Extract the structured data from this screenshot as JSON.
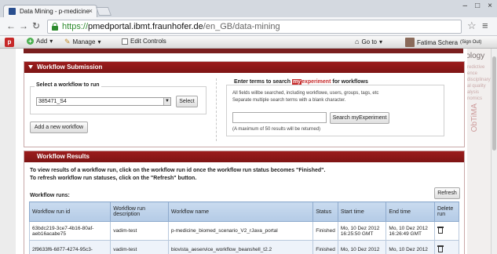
{
  "browser": {
    "tab_title": "Data Mining - p-medicine",
    "tab_close": "×",
    "window_controls": [
      "–",
      "□",
      "×"
    ],
    "url_scheme": "https://",
    "url_host": "pmedportal.ibmt.fraunhofer.de",
    "url_path": "/en_GB/data-mining",
    "back": "←",
    "forward": "→",
    "reload": "↻",
    "star": "☆",
    "menu": "≡"
  },
  "portalbar": {
    "logo": "p",
    "add_label": "Add",
    "manage_label": "Manage",
    "edit_controls_label": "Edit Controls",
    "goto_label": "Go to",
    "user_name": "Fatima Schera",
    "sign_out": "(Sign Out)"
  },
  "sideart": {
    "oncology": "Oncology",
    "vertical_text": "ObTiMA",
    "faint_lines": [
      "redictive",
      "ence",
      "disciplinary",
      "al quality",
      "alysis",
      "nomics"
    ]
  },
  "workflow_submission": {
    "title": "Workflow Submission",
    "select_label": "Select a workflow to run",
    "selected_workflow": "385471_S4",
    "select_button": "Select",
    "add_button": "Add a new workflow",
    "search_title_pre": "Enter terms to search",
    "search_brand_my": "my",
    "search_brand_exp": "experiment",
    "search_title_post": "for workflows",
    "search_help_1": "All fields willbe searched, including workflowe, users, groups, tags, etc",
    "search_help_2": "Separate multiple search terms with a blank character.",
    "search_input_value": "",
    "search_button": "Search myExperiment",
    "search_max": "(A maximum of 50 results will be returned)"
  },
  "workflow_results": {
    "title": "Workflow Results",
    "instruction_1": "To view results of a workflow run, click on the workflow run id once the workflow run status becomes \"Finished\".",
    "instruction_2": "To refresh workflow run statuses, click on the \"Refresh\" button.",
    "runs_label": "Workflow runs:",
    "refresh_button": "Refresh",
    "columns": [
      "Workflow run id",
      "Workflow run description",
      "Workflow name",
      "Status",
      "Start time",
      "End time",
      "Delete run"
    ],
    "rows": [
      {
        "id": "63bdc219-3ce7-4b16-80af-aeb16acabe75",
        "description": "vadim-test",
        "name": "p-medicine_biomed_scenario_V2_rJava_portal",
        "status": "Finished",
        "start": "Mo, 10 Dez 2012 16:25:50 GMT",
        "end": "Mo, 10 Dez 2012 16:26:49 GMT"
      },
      {
        "id": "2f9633f6-6877-4274-95c3-",
        "description": "vadim-test",
        "name": "biovista_aeservice_workflow_beanshell_t2.2",
        "status": "Finished",
        "start": "Mo, 10 Dez 2012",
        "end": "Mo, 10 Dez 2012"
      }
    ]
  }
}
